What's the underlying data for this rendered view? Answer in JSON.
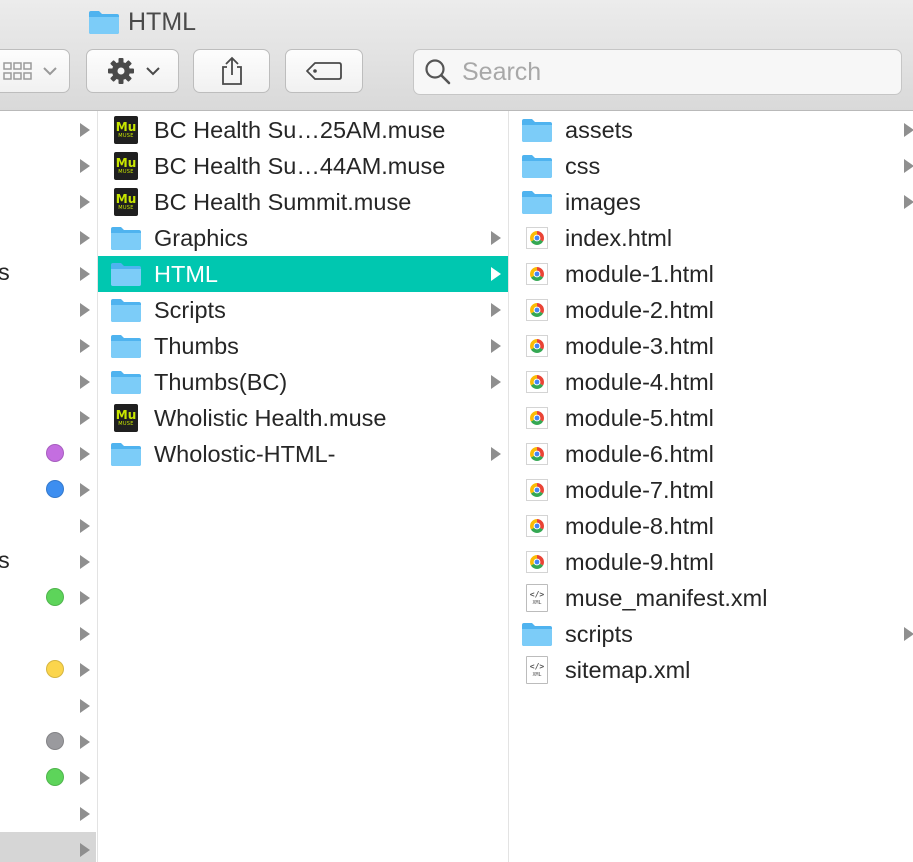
{
  "window": {
    "title": "HTML"
  },
  "toolbar": {
    "view_icon": "grid-icon",
    "action_icon": "gear-icon",
    "share_icon": "share-icon",
    "tags_icon": "tag-icon"
  },
  "search": {
    "placeholder": "Search",
    "value": ""
  },
  "left_column": {
    "rows": [
      {
        "text": "",
        "dot": null
      },
      {
        "text": "",
        "dot": null
      },
      {
        "text": "",
        "dot": null
      },
      {
        "text": "",
        "dot": null
      },
      {
        "text": "s",
        "dot": null
      },
      {
        "text": "",
        "dot": null
      },
      {
        "text": "",
        "dot": null
      },
      {
        "text": "",
        "dot": null
      },
      {
        "text": "",
        "dot": null
      },
      {
        "text": "",
        "dot": "#c46ee0"
      },
      {
        "text": "",
        "dot": "#3d8ef0"
      },
      {
        "text": "",
        "dot": null
      },
      {
        "text": "s",
        "dot": null
      },
      {
        "text": "",
        "dot": "#5dd45a"
      },
      {
        "text": "",
        "dot": null
      },
      {
        "text": "",
        "dot": "#fbd54c"
      },
      {
        "text": "",
        "dot": null
      },
      {
        "text": "",
        "dot": "#9a9a9e"
      },
      {
        "text": "",
        "dot": "#5dd45a"
      },
      {
        "text": "",
        "dot": null
      },
      {
        "text": "",
        "dot": null
      }
    ]
  },
  "middle_column": {
    "items": [
      {
        "name": "BC Health Su…25AM.muse",
        "type": "muse",
        "expandable": false,
        "selected": false
      },
      {
        "name": "BC Health Su…44AM.muse",
        "type": "muse",
        "expandable": false,
        "selected": false
      },
      {
        "name": "BC Health Summit.muse",
        "type": "muse",
        "expandable": false,
        "selected": false
      },
      {
        "name": "Graphics",
        "type": "folder",
        "expandable": true,
        "selected": false
      },
      {
        "name": "HTML",
        "type": "folder",
        "expandable": true,
        "selected": true
      },
      {
        "name": "Scripts",
        "type": "folder",
        "expandable": true,
        "selected": false
      },
      {
        "name": "Thumbs",
        "type": "folder",
        "expandable": true,
        "selected": false
      },
      {
        "name": "Thumbs(BC)",
        "type": "folder",
        "expandable": true,
        "selected": false
      },
      {
        "name": "Wholistic Health.muse",
        "type": "muse",
        "expandable": false,
        "selected": false
      },
      {
        "name": "Wholostic-HTML-",
        "type": "folder",
        "expandable": true,
        "selected": false
      }
    ]
  },
  "right_column": {
    "items": [
      {
        "name": "assets",
        "type": "folder",
        "expandable": true
      },
      {
        "name": "css",
        "type": "folder",
        "expandable": true
      },
      {
        "name": "images",
        "type": "folder",
        "expandable": true
      },
      {
        "name": "index.html",
        "type": "html",
        "expandable": false
      },
      {
        "name": "module-1.html",
        "type": "html",
        "expandable": false
      },
      {
        "name": "module-2.html",
        "type": "html",
        "expandable": false
      },
      {
        "name": "module-3.html",
        "type": "html",
        "expandable": false
      },
      {
        "name": "module-4.html",
        "type": "html",
        "expandable": false
      },
      {
        "name": "module-5.html",
        "type": "html",
        "expandable": false
      },
      {
        "name": "module-6.html",
        "type": "html",
        "expandable": false
      },
      {
        "name": "module-7.html",
        "type": "html",
        "expandable": false
      },
      {
        "name": "module-8.html",
        "type": "html",
        "expandable": false
      },
      {
        "name": "module-9.html",
        "type": "html",
        "expandable": false
      },
      {
        "name": "muse_manifest.xml",
        "type": "xml",
        "expandable": false
      },
      {
        "name": "scripts",
        "type": "folder",
        "expandable": true
      },
      {
        "name": "sitemap.xml",
        "type": "xml",
        "expandable": false
      }
    ]
  },
  "colors": {
    "selection": "#00c7b0",
    "folder": "#5cbdf5",
    "muse_text": "#c8e600"
  }
}
